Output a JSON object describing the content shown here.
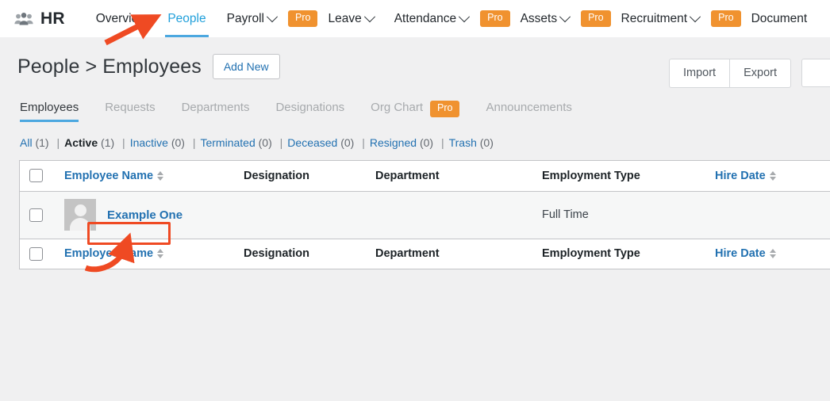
{
  "topnav": {
    "brand": "HR",
    "brand_icon": "people-group-icon",
    "items": [
      {
        "label": "Overview",
        "caret": false,
        "pro": false,
        "active": false
      },
      {
        "label": "People",
        "caret": false,
        "pro": false,
        "active": true
      },
      {
        "label": "Payroll",
        "caret": true,
        "pro": true,
        "active": false
      },
      {
        "label": "Leave",
        "caret": true,
        "pro": false,
        "active": false
      },
      {
        "label": "Attendance",
        "caret": true,
        "pro": true,
        "active": false
      },
      {
        "label": "Assets",
        "caret": true,
        "pro": true,
        "active": false
      },
      {
        "label": "Recruitment",
        "caret": true,
        "pro": true,
        "active": false
      },
      {
        "label": "Document",
        "caret": false,
        "pro": false,
        "active": false
      }
    ],
    "pro_badge_label": "Pro",
    "pro_badge_color": "#f0922f",
    "active_color": "#21a0db"
  },
  "page": {
    "title": "People > Employees",
    "add_new_label": "Add New",
    "import_label": "Import",
    "export_label": "Export"
  },
  "tabs": [
    {
      "label": "Employees",
      "active": true,
      "pro": false
    },
    {
      "label": "Requests",
      "active": false,
      "pro": false
    },
    {
      "label": "Departments",
      "active": false,
      "pro": false
    },
    {
      "label": "Designations",
      "active": false,
      "pro": false
    },
    {
      "label": "Org Chart",
      "active": false,
      "pro": true
    },
    {
      "label": "Announcements",
      "active": false,
      "pro": false
    }
  ],
  "filters": [
    {
      "label": "All",
      "count": "(1)",
      "current": false
    },
    {
      "label": "Active",
      "count": "(1)",
      "current": true
    },
    {
      "label": "Inactive",
      "count": "(0)",
      "current": false
    },
    {
      "label": "Terminated",
      "count": "(0)",
      "current": false
    },
    {
      "label": "Deceased",
      "count": "(0)",
      "current": false
    },
    {
      "label": "Resigned",
      "count": "(0)",
      "current": false
    },
    {
      "label": "Trash",
      "count": "(0)",
      "current": false
    }
  ],
  "table": {
    "columns": [
      {
        "label": "Employee Name",
        "sortable": true,
        "link": true
      },
      {
        "label": "Designation",
        "sortable": false,
        "link": false
      },
      {
        "label": "Department",
        "sortable": false,
        "link": false
      },
      {
        "label": "Employment Type",
        "sortable": false,
        "link": false
      },
      {
        "label": "Hire Date",
        "sortable": true,
        "link": true
      }
    ],
    "rows": [
      {
        "name": "Example One",
        "designation": "",
        "department": "",
        "employment_type": "Full Time",
        "hire_date": "",
        "avatar": "default-avatar-icon"
      }
    ]
  },
  "annotations": {
    "color": "#ef4a23",
    "arrow_to_people_nav": "arrow-pointing-to-people-nav-item",
    "arrow_to_employee_name": "curved-arrow-pointing-to-employee-name",
    "highlight_box_target": "Example One"
  }
}
